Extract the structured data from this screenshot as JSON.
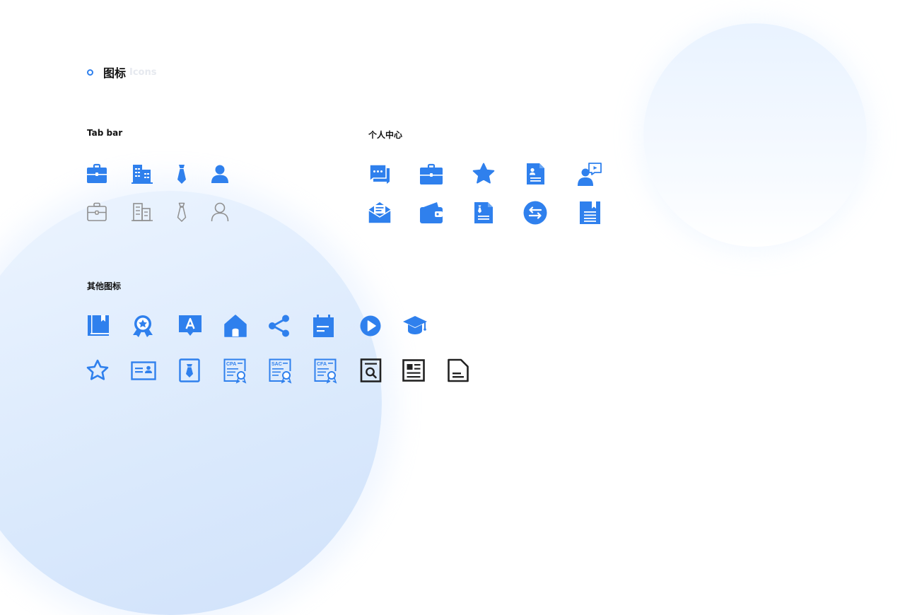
{
  "header": {
    "title": "图标",
    "subtitle": "Icons"
  },
  "sections": {
    "tabbar": {
      "label": "Tab bar"
    },
    "personal": {
      "label": "个人中心"
    },
    "other": {
      "label": "其他图标"
    }
  },
  "certificates": {
    "cpa": "CPA",
    "sac": "SAC",
    "cfa": "CFA"
  },
  "colors": {
    "accent": "#2f80ed",
    "inactive": "#8f8f8f",
    "dark": "#222222"
  }
}
